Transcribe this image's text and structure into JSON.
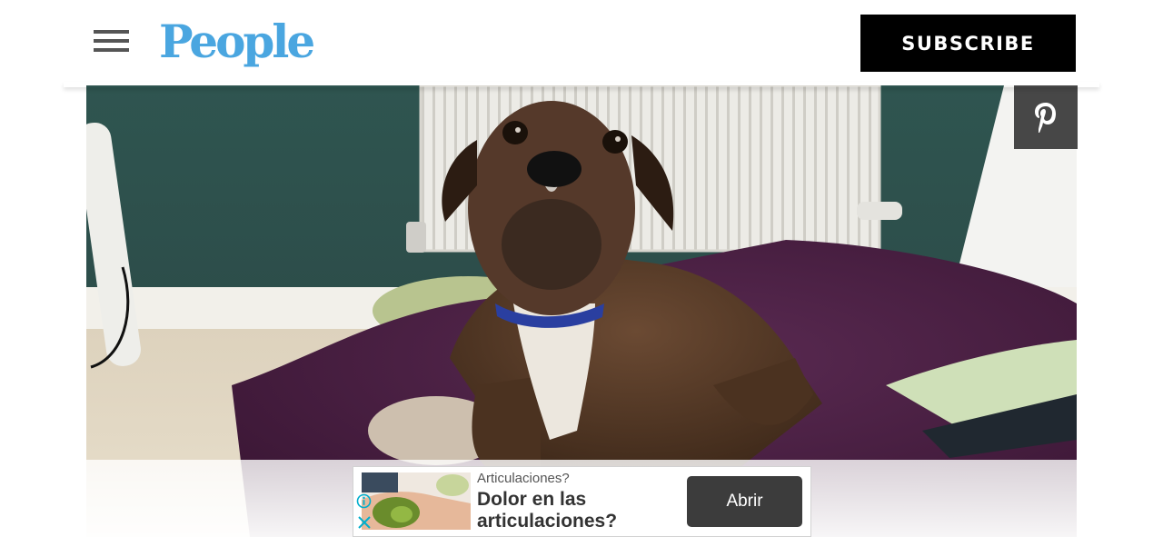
{
  "header": {
    "logo_text": "People",
    "subscribe_label": "SUBSCRIBE"
  },
  "icons": {
    "menu": "hamburger-menu-icon",
    "share": "pinterest-icon",
    "ad_info": "info-icon",
    "ad_close": "close-icon"
  },
  "colors": {
    "brand_blue": "#4aa6e0",
    "subscribe_bg": "#000000",
    "pin_bg": "#474747",
    "ad_cta_bg": "#3c3c3c"
  },
  "ad": {
    "kicker": "Articulaciones?",
    "headline": "Dolor en las articulaciones?",
    "cta_label": "Abrir"
  }
}
